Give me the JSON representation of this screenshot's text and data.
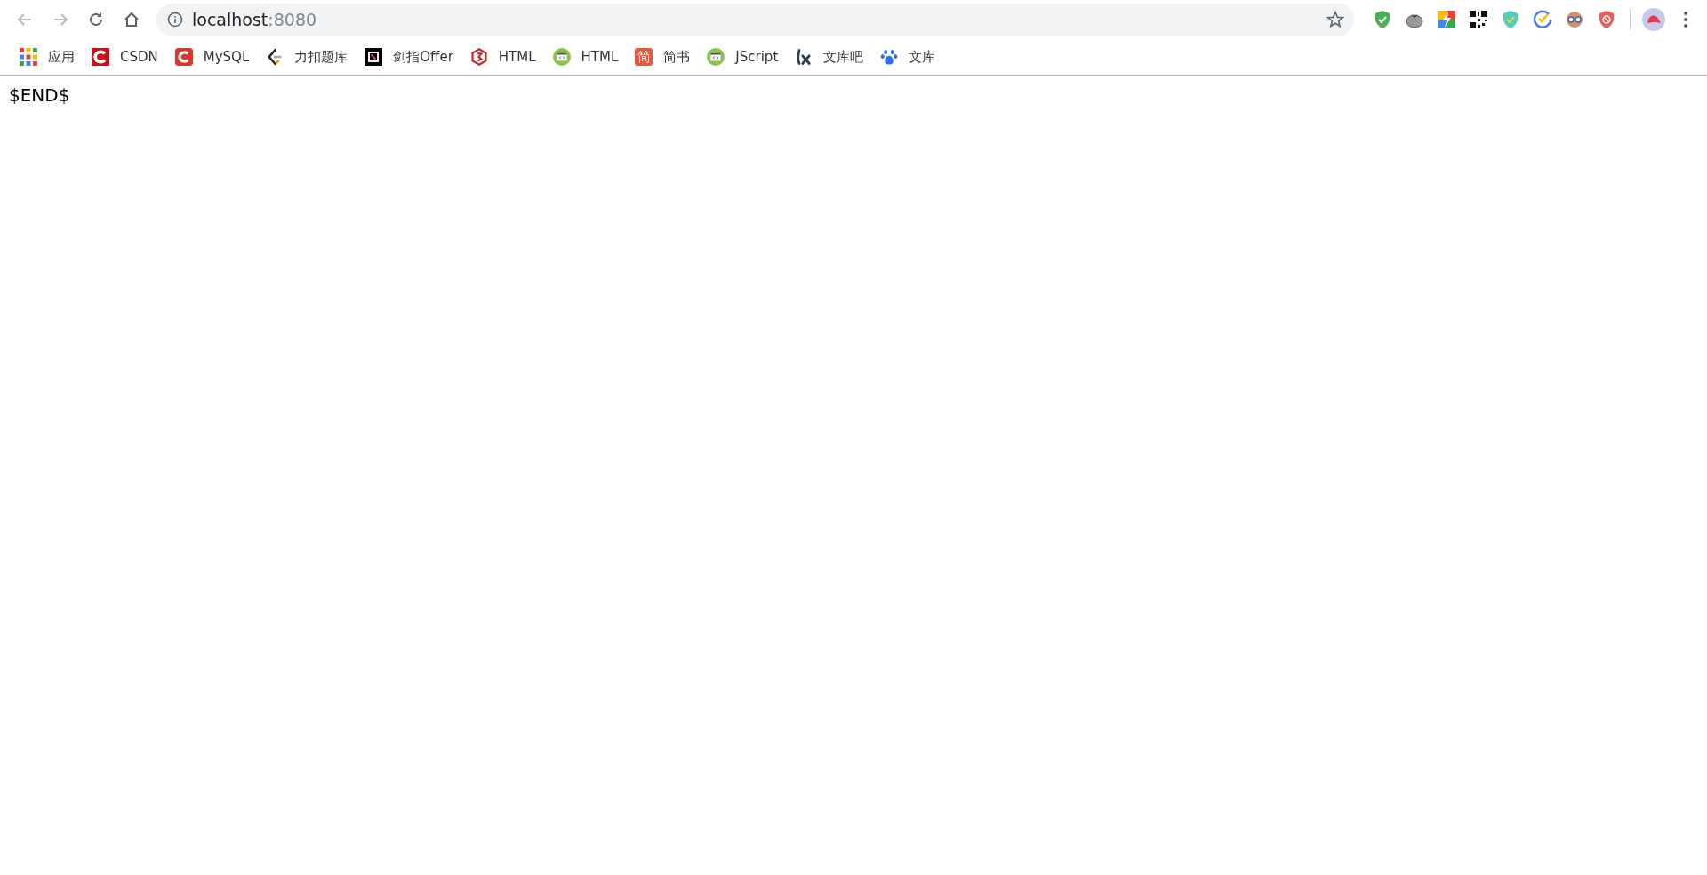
{
  "address_bar": {
    "host": "localhost",
    "port": ":8080"
  },
  "bookmarks": [
    {
      "kind": "apps",
      "label": "应用"
    },
    {
      "kind": "csdn",
      "label": "CSDN"
    },
    {
      "kind": "mysql",
      "label": "MySQL"
    },
    {
      "kind": "leetcode",
      "label": "力扣题库"
    },
    {
      "kind": "offer",
      "label": "剑指Offer"
    },
    {
      "kind": "html5",
      "label": "HTML"
    },
    {
      "kind": "code",
      "label": "HTML"
    },
    {
      "kind": "jianshu",
      "label": "简书",
      "icon_text": "简"
    },
    {
      "kind": "code",
      "label": "JScript"
    },
    {
      "kind": "lx",
      "label": "文库吧"
    },
    {
      "kind": "paw",
      "label": "文库"
    }
  ],
  "extensions": [
    {
      "kind": "shield-check"
    },
    {
      "kind": "tomato"
    },
    {
      "kind": "bolt"
    },
    {
      "kind": "qr"
    },
    {
      "kind": "shield-green"
    },
    {
      "kind": "check-circle"
    },
    {
      "kind": "goggles"
    },
    {
      "kind": "block"
    }
  ],
  "page": {
    "text": "$END$"
  }
}
